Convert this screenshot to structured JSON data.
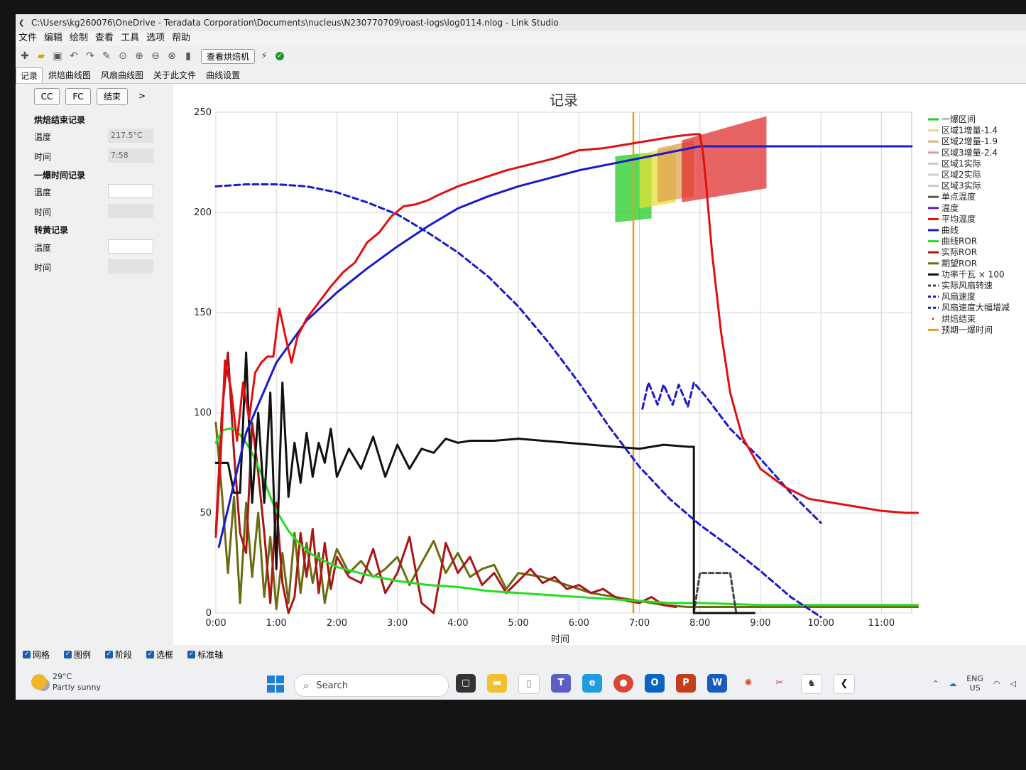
{
  "window": {
    "title": "C:\\Users\\kg260076\\OneDrive - Teradata Corporation\\Documents\\nucleus\\N230770709\\roast-logs\\log0114.nlog - Link Studio"
  },
  "menu": [
    "文件",
    "编辑",
    "绘制",
    "查看",
    "工具",
    "选项",
    "帮助"
  ],
  "toolbar": {
    "view_roaster_label": "查看烘焙机",
    "status_ok": "✓"
  },
  "tabs": [
    "记录",
    "烘焙曲线图",
    "风扇曲线图",
    "关于此文件",
    "曲线设置"
  ],
  "left_panel": {
    "buttons": [
      "CC",
      "FC",
      "结束",
      ">"
    ],
    "roast_end": {
      "title": "烘焙结束记录",
      "temp_label": "温度",
      "temp_value": "217.5°C",
      "time_label": "时间",
      "time_value": "7:58"
    },
    "first_crack": {
      "title": "一爆时间记录",
      "temp_label": "温度",
      "temp_value": "",
      "time_label": "时间",
      "time_value": ""
    },
    "turning": {
      "title": "转黄记录",
      "temp_label": "温度",
      "temp_value": "",
      "time_label": "时间",
      "time_value": ""
    }
  },
  "bottom_checks": [
    "网格",
    "图例",
    "阶段",
    "选框",
    "标准轴"
  ],
  "taskbar": {
    "weather_temp": "29°C",
    "weather_desc": "Partly sunny",
    "search_placeholder": "Search",
    "lang_top": "ENG",
    "lang_bottom": "US"
  },
  "chart_data": {
    "type": "line",
    "title": "记录",
    "xlabel": "时间",
    "ylabel": "",
    "xlim": [
      0,
      11.5
    ],
    "ylim": [
      0,
      250
    ],
    "x_ticks": [
      "0:00",
      "1:00",
      "2:00",
      "3:00",
      "4:00",
      "5:00",
      "6:00",
      "7:00",
      "8:00",
      "9:00",
      "10:00",
      "11:00"
    ],
    "y_ticks": [
      0,
      50,
      100,
      150,
      200,
      250
    ],
    "grid": true,
    "legend_position": "right",
    "legend": [
      {
        "name": "一爆区间",
        "color": "#22cc22",
        "style": "solid"
      },
      {
        "name": "区域1增量-1.4",
        "color": "#e8d69a",
        "style": "solid"
      },
      {
        "name": "区域2增量-1.9",
        "color": "#e0b07a",
        "style": "solid"
      },
      {
        "name": "区域3增量-2.4",
        "color": "#e09a9a",
        "style": "solid"
      },
      {
        "name": "区域1实际",
        "color": "#cccccc",
        "style": "solid"
      },
      {
        "name": "区域2实际",
        "color": "#cccccc",
        "style": "solid"
      },
      {
        "name": "区域3实际",
        "color": "#cccccc",
        "style": "solid"
      },
      {
        "name": "单点温度",
        "color": "#555555",
        "style": "solid"
      },
      {
        "name": "温度",
        "color": "#6a1fc0",
        "style": "solid"
      },
      {
        "name": "平均温度",
        "color": "#e01010",
        "style": "solid"
      },
      {
        "name": "曲线",
        "color": "#1a1acc",
        "style": "solid"
      },
      {
        "name": "曲线ROR",
        "color": "#22dd22",
        "style": "solid"
      },
      {
        "name": "实际ROR",
        "color": "#aa1515",
        "style": "solid"
      },
      {
        "name": "期望ROR",
        "color": "#6b6b10",
        "style": "solid"
      },
      {
        "name": "功率千瓦 × 100",
        "color": "#111111",
        "style": "solid"
      },
      {
        "name": "实际风扇转速",
        "color": "#444444",
        "style": "dash"
      },
      {
        "name": "风扇速度",
        "color": "#1a1acc",
        "style": "dash"
      },
      {
        "name": "风扇速度大幅增减",
        "color": "#1a1acc",
        "style": "dash"
      },
      {
        "name": "烘焙结束",
        "color": "#e01010",
        "style": "dot"
      },
      {
        "name": "预期一爆时间",
        "color": "#e0a020",
        "style": "solid"
      }
    ],
    "first_crack_expected_time": 6.9,
    "zones": [
      {
        "color": "#22cc22",
        "x0": 6.6,
        "x1": 7.2,
        "y_lo_start": 195,
        "y_lo_end": 197,
        "y_hi_start": 228,
        "y_hi_end": 230
      },
      {
        "color": "#e6e03a",
        "x0": 7.0,
        "x1": 7.6,
        "y_lo_start": 202,
        "y_lo_end": 205,
        "y_hi_start": 229,
        "y_hi_end": 233
      },
      {
        "color": "#e0a050",
        "x0": 7.3,
        "x1": 7.9,
        "y_lo_start": 205,
        "y_lo_end": 208,
        "y_hi_start": 232,
        "y_hi_end": 236
      },
      {
        "color": "#e03030",
        "x0": 7.7,
        "x1": 9.1,
        "y_lo_start": 205,
        "y_lo_end": 212,
        "y_hi_start": 236,
        "y_hi_end": 248
      }
    ],
    "series": [
      {
        "name": "曲线",
        "color": "#1a1acc",
        "x": [
          0.05,
          0.5,
          1.0,
          1.5,
          2.0,
          2.5,
          3.0,
          3.5,
          4.0,
          4.5,
          5.0,
          5.5,
          6.0,
          6.5,
          7.0,
          7.5,
          8.0,
          8.5,
          9.0,
          10.0,
          11.0,
          11.5
        ],
        "y": [
          33,
          90,
          125,
          146,
          160,
          172,
          183,
          193,
          202,
          208,
          213,
          217,
          221,
          224,
          227,
          230,
          233,
          233,
          233,
          233,
          233,
          233
        ]
      },
      {
        "name": "平均温度",
        "color": "#e01010",
        "x": [
          0.0,
          0.08,
          0.15,
          0.25,
          0.35,
          0.45,
          0.55,
          0.65,
          0.75,
          0.85,
          0.95,
          1.05,
          1.15,
          1.25,
          1.35,
          1.5,
          1.7,
          1.9,
          2.1,
          2.3,
          2.5,
          2.7,
          2.9,
          3.1,
          3.3,
          3.5,
          3.7,
          4.0,
          4.4,
          4.8,
          5.2,
          5.6,
          6.0,
          6.4,
          6.8,
          7.2,
          7.6,
          7.9,
          8.0,
          8.05,
          8.1,
          8.2,
          8.35,
          8.5,
          8.7,
          9.0,
          9.4,
          9.8,
          10.2,
          10.6,
          11.0,
          11.4,
          11.6
        ],
        "y": [
          38,
          78,
          126,
          112,
          86,
          115,
          97,
          120,
          125,
          128,
          128,
          152,
          138,
          125,
          138,
          147,
          155,
          163,
          170,
          175,
          185,
          190,
          198,
          203,
          204,
          206,
          209,
          213,
          217,
          221,
          224,
          227,
          231,
          232,
          234,
          236,
          238,
          239,
          239,
          230,
          215,
          180,
          140,
          110,
          88,
          72,
          63,
          57,
          55,
          53,
          51,
          50,
          50
        ]
      },
      {
        "name": "风扇速度",
        "color": "#1a1acc",
        "x": [
          0.0,
          0.5,
          1.0,
          1.5,
          2.0,
          2.5,
          3.0,
          3.5,
          4.0,
          4.5,
          5.0,
          5.5,
          6.0,
          6.5,
          7.0,
          7.5,
          8.0,
          8.5,
          9.0,
          9.5,
          10.0
        ],
        "y": [
          213,
          214,
          214,
          213,
          210,
          205,
          199,
          190,
          180,
          168,
          153,
          135,
          115,
          93,
          73,
          57,
          44,
          33,
          21,
          8,
          -4
        ]
      },
      {
        "name": "风扇速度大幅增减",
        "color": "#1a1acc",
        "x": [
          7.05,
          7.15,
          7.3,
          7.4,
          7.55,
          7.65,
          7.8,
          7.9,
          8.1,
          8.5,
          9.0,
          9.5,
          10.0
        ],
        "y": [
          102,
          115,
          104,
          114,
          104,
          114,
          103,
          115,
          108,
          92,
          77,
          60,
          45
        ]
      },
      {
        "name": "功率千瓦 × 100",
        "color": "#111111",
        "x": [
          0.0,
          0.2,
          0.3,
          0.4,
          0.5,
          0.6,
          0.7,
          0.8,
          0.9,
          1.0,
          1.1,
          1.2,
          1.3,
          1.4,
          1.5,
          1.6,
          1.7,
          1.8,
          1.9,
          2.0,
          2.2,
          2.4,
          2.6,
          2.8,
          3.0,
          3.2,
          3.4,
          3.6,
          3.8,
          4.0,
          4.2,
          4.6,
          5.0,
          5.4,
          5.8,
          6.2,
          6.6,
          7.0,
          7.4,
          7.8,
          7.9,
          7.9,
          8.5,
          8.9
        ],
        "y": [
          75,
          75,
          60,
          60,
          130,
          55,
          100,
          55,
          110,
          22,
          115,
          58,
          85,
          65,
          90,
          68,
          85,
          75,
          92,
          68,
          82,
          72,
          88,
          68,
          84,
          72,
          82,
          80,
          87,
          85,
          86,
          86,
          87,
          86,
          85,
          84,
          83,
          82,
          84,
          83,
          83,
          0,
          0,
          0
        ]
      },
      {
        "name": "实际风扇转速",
        "color": "#444444",
        "x": [
          7.9,
          8.0,
          8.5,
          8.6
        ],
        "y": [
          0,
          20,
          20,
          0
        ]
      },
      {
        "name": "曲线ROR",
        "color": "#22dd22",
        "x": [
          0.0,
          0.1,
          0.2,
          0.3,
          0.4,
          0.5,
          0.6,
          0.7,
          0.8,
          0.9,
          1.0,
          1.2,
          1.4,
          1.6,
          1.8,
          2.0,
          2.5,
          3.0,
          3.5,
          4.0,
          4.5,
          5.0,
          5.5,
          6.0,
          6.5,
          7.0,
          7.5,
          8.0,
          9.0,
          10.0,
          11.0,
          11.6
        ],
        "y": [
          85,
          91,
          92,
          92,
          89,
          85,
          80,
          73,
          66,
          58,
          51,
          41,
          34,
          29,
          26,
          23,
          19,
          16,
          14,
          13,
          11,
          10,
          9,
          8,
          7,
          6,
          5,
          5,
          4,
          4,
          4,
          4
        ]
      },
      {
        "name": "实际ROR",
        "color": "#aa1515",
        "x": [
          0.0,
          0.1,
          0.2,
          0.3,
          0.4,
          0.5,
          0.6,
          0.7,
          0.8,
          0.9,
          1.0,
          1.1,
          1.2,
          1.3,
          1.4,
          1.5,
          1.6,
          1.7,
          1.8,
          1.9,
          2.0,
          2.2,
          2.4,
          2.6,
          2.8,
          3.0,
          3.2,
          3.4,
          3.6,
          3.8,
          4.0,
          4.2,
          4.4,
          4.6,
          4.8,
          5.0,
          5.2,
          5.4,
          5.6,
          5.8,
          6.0,
          6.2,
          6.4,
          6.6,
          6.8,
          7.0,
          7.2,
          7.4,
          7.6
        ],
        "y": [
          40,
          100,
          130,
          80,
          40,
          30,
          95,
          70,
          40,
          5,
          55,
          15,
          0,
          8,
          40,
          18,
          42,
          10,
          35,
          12,
          28,
          18,
          15,
          32,
          10,
          20,
          38,
          5,
          0,
          35,
          20,
          28,
          14,
          20,
          10,
          16,
          22,
          15,
          18,
          12,
          14,
          10,
          12,
          8,
          6,
          5,
          8,
          4,
          3
        ]
      },
      {
        "name": "期望ROR",
        "color": "#6b6b10",
        "x": [
          0.0,
          0.1,
          0.2,
          0.3,
          0.4,
          0.5,
          0.6,
          0.7,
          0.8,
          0.9,
          1.0,
          1.1,
          1.2,
          1.3,
          1.4,
          1.5,
          1.6,
          1.7,
          1.8,
          1.9,
          2.0,
          2.2,
          2.4,
          2.6,
          2.8,
          3.0,
          3.2,
          3.4,
          3.6,
          3.8,
          4.0,
          4.2,
          4.4,
          4.6,
          4.8,
          5.0,
          5.4,
          5.8,
          6.2,
          6.6,
          7.0,
          7.4,
          7.8,
          8.0,
          9.0,
          10.0,
          11.0,
          11.6
        ],
        "y": [
          95,
          60,
          20,
          58,
          5,
          55,
          18,
          50,
          8,
          38,
          2,
          30,
          5,
          40,
          10,
          35,
          15,
          30,
          5,
          22,
          32,
          20,
          26,
          18,
          22,
          28,
          14,
          25,
          36,
          20,
          30,
          18,
          22,
          24,
          12,
          20,
          18,
          14,
          10,
          8,
          6,
          4,
          3,
          3,
          3,
          3,
          3,
          3
        ]
      }
    ]
  }
}
